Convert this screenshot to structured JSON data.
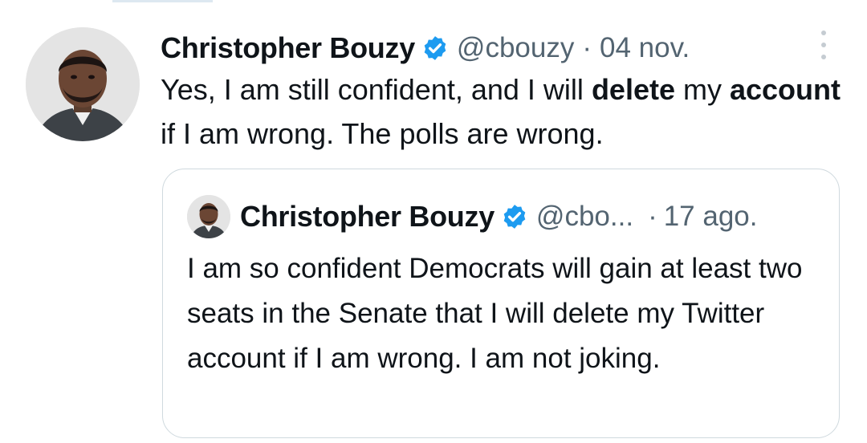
{
  "tweet": {
    "author_name": "Christopher Bouzy",
    "handle": "@cbouzy",
    "separator": "·",
    "date": "04 nov.",
    "text": {
      "part1": "Yes, I am still confident, and I will ",
      "bold1": "delete",
      "part2": " my ",
      "bold2": "account",
      "part3": " if I am wrong. The polls are wrong."
    },
    "icons": {
      "verified": "verified-badge-icon",
      "more": "more-options-icon"
    }
  },
  "quoted_tweet": {
    "author_name": "Christopher Bouzy",
    "handle": "@cbo...",
    "separator": "·",
    "date": "17 ago.",
    "text": "I am so confident Democrats will gain at least two seats in the Senate that I will delete my Twitter account if I am wrong. I am not joking."
  },
  "colors": {
    "text_primary": "#0f1419",
    "text_secondary": "#536471",
    "verified_blue": "#1d9bf0",
    "border": "#cfd9de"
  }
}
